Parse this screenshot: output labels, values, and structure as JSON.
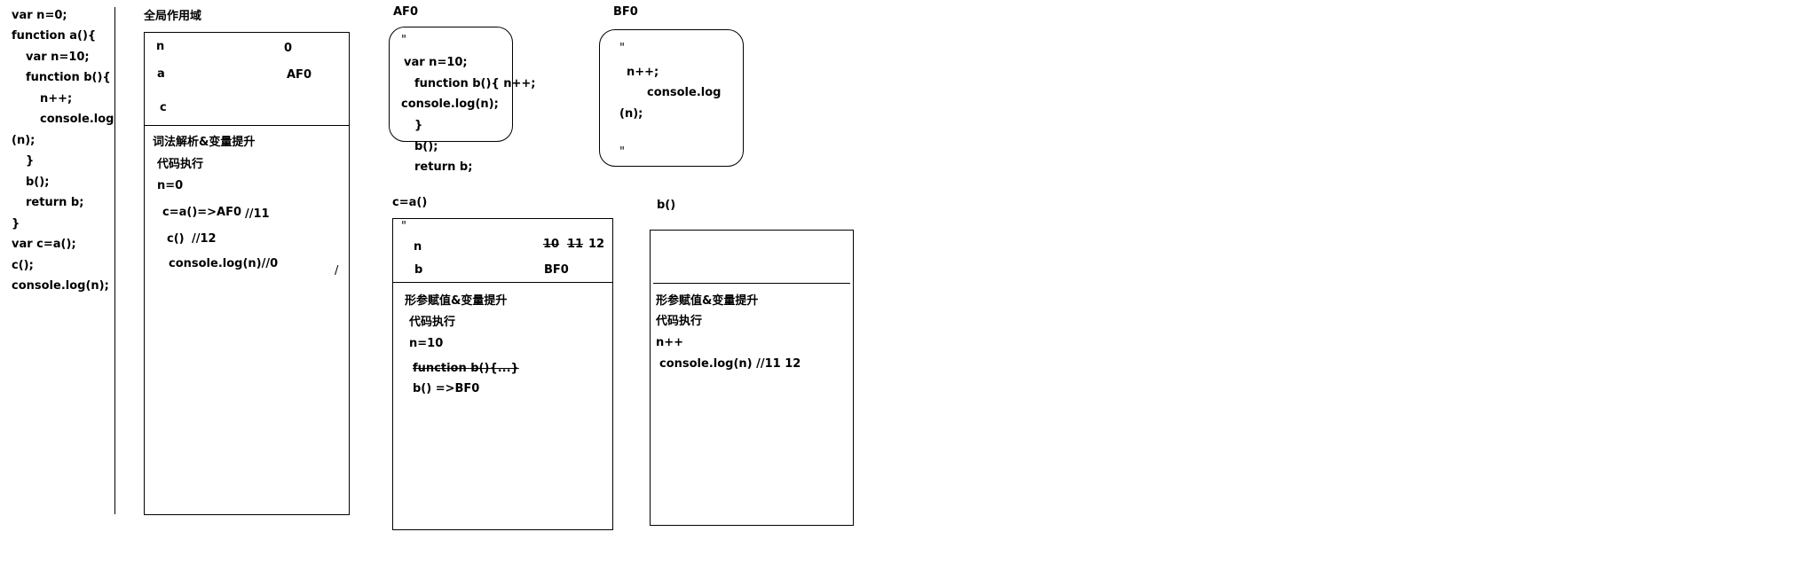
{
  "code": {
    "lines": [
      "var n=0;",
      "function a(){",
      "var n=10;",
      "function b(){",
      "n++;",
      "console.log",
      "(n);",
      "}",
      "b();",
      "return b;",
      "}",
      "var c=a();",
      "c();",
      "console.log(n);"
    ]
  },
  "global": {
    "title": "全局作用域",
    "var_n": "n",
    "val_n": "0",
    "var_a": "a",
    "val_a": "AF0",
    "var_c": "c",
    "steps": [
      "词法解析&变量提升",
      "代码执行",
      "n=0",
      "c=a()=>AF0",
      "//11",
      "c()",
      "//12",
      "console.log(n)//0",
      "/"
    ]
  },
  "af0": {
    "title": "AF0",
    "lines": [
      "\"",
      "var n=10;",
      "function b(){ n++;",
      "console.log(n);",
      "}",
      "b();",
      "return b;"
    ]
  },
  "bf0": {
    "title": "BF0",
    "lines": [
      "\"",
      "n++;",
      "console.log",
      "(n);",
      "\""
    ]
  },
  "ca": {
    "title": "c=a()",
    "quote": "\"",
    "var_n": "n",
    "val_n1": "10",
    "val_n2": "11",
    "val_n3": "12",
    "var_b": "b",
    "val_b": "BF0",
    "steps": [
      "形参赋值&变量提升",
      "代码执行",
      "n=10",
      "function b(){...}",
      "b() =>BF0"
    ]
  },
  "b_call": {
    "title": "b()",
    "steps": [
      "形参赋值&变量提升",
      "代码执行",
      "n++",
      "console.log(n) //11  12"
    ]
  }
}
